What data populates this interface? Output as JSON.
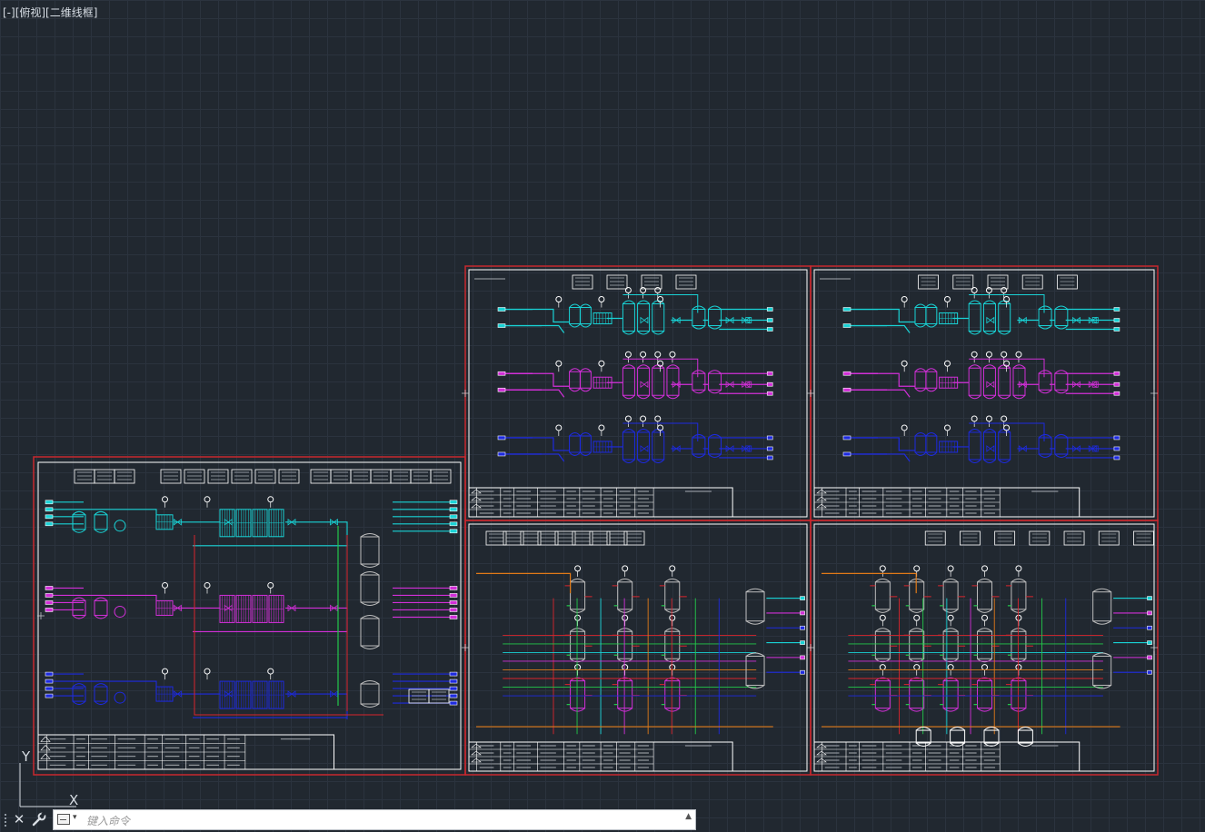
{
  "viewport": {
    "label": "[-][俯视][二维线框]"
  },
  "command_line": {
    "placeholder": "键入命令",
    "close_glyph": "✕",
    "dropdown_glyph": "▾",
    "scroll_glyph": "▲"
  },
  "ucs": {
    "y_label": "Y",
    "x_label": "X"
  },
  "colors": {
    "background": "#212830",
    "grid": "#2b333e",
    "sheet_border": "#c8282e",
    "frame": "#ffffff",
    "cyan": "#19d3d6",
    "magenta": "#d22fd8",
    "blue": "#1d2ae0",
    "green": "#22c94a",
    "red": "#d9242c",
    "orange": "#e07a18"
  },
  "sheets": [
    {
      "name": "sheet-left",
      "title_block_rows": 4,
      "layout": "three-train"
    },
    {
      "name": "sheet-top-middle",
      "title_block_rows": 4,
      "layout": "three-train"
    },
    {
      "name": "sheet-top-right",
      "title_block_rows": 4,
      "layout": "three-train"
    },
    {
      "name": "sheet-bottom-middle",
      "title_block_rows": 4,
      "layout": "tank-array"
    },
    {
      "name": "sheet-bottom-right",
      "title_block_rows": 4,
      "layout": "tank-array"
    }
  ]
}
